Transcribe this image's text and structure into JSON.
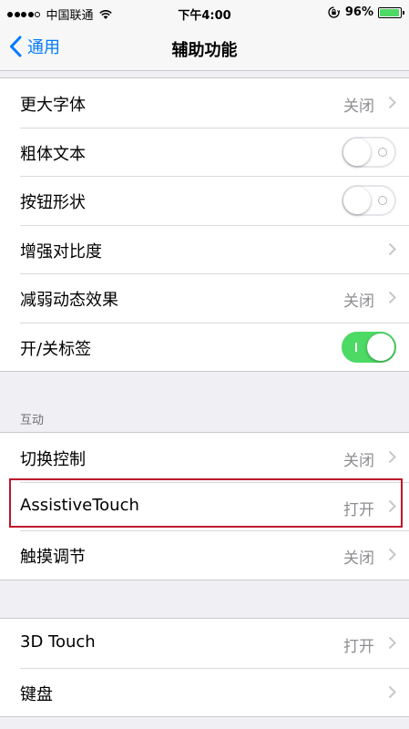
{
  "status_bar": {
    "carrier": "中国联通",
    "time": "下午4:00",
    "battery_percent": "96%",
    "battery_level": 0.96,
    "signal_strength": 4,
    "signal_max": 5
  },
  "nav": {
    "back_label": "通用",
    "title": "辅助功能"
  },
  "group1": {
    "rows": [
      {
        "label": "更大字体",
        "value": "关闭"
      },
      {
        "label": "粗体文本",
        "switch": "off"
      },
      {
        "label": "按钮形状",
        "switch": "off"
      },
      {
        "label": "增强对比度",
        "value": ""
      },
      {
        "label": "减弱动态效果",
        "value": "关闭"
      },
      {
        "label": "开/关标签",
        "switch": "on"
      }
    ]
  },
  "interaction_section": {
    "header": "互动",
    "rows": [
      {
        "label": "切换控制",
        "value": "关闭"
      },
      {
        "label": "AssistiveTouch",
        "value": "打开"
      },
      {
        "label": "触摸调节",
        "value": "关闭"
      }
    ]
  },
  "group3": {
    "rows": [
      {
        "label": "3D Touch",
        "value": "打开"
      },
      {
        "label": "键盘",
        "value": ""
      }
    ]
  },
  "colors": {
    "accent": "#007aff",
    "switch_on": "#4cd964",
    "highlight": "#c0142a",
    "background": "#efeff4"
  }
}
